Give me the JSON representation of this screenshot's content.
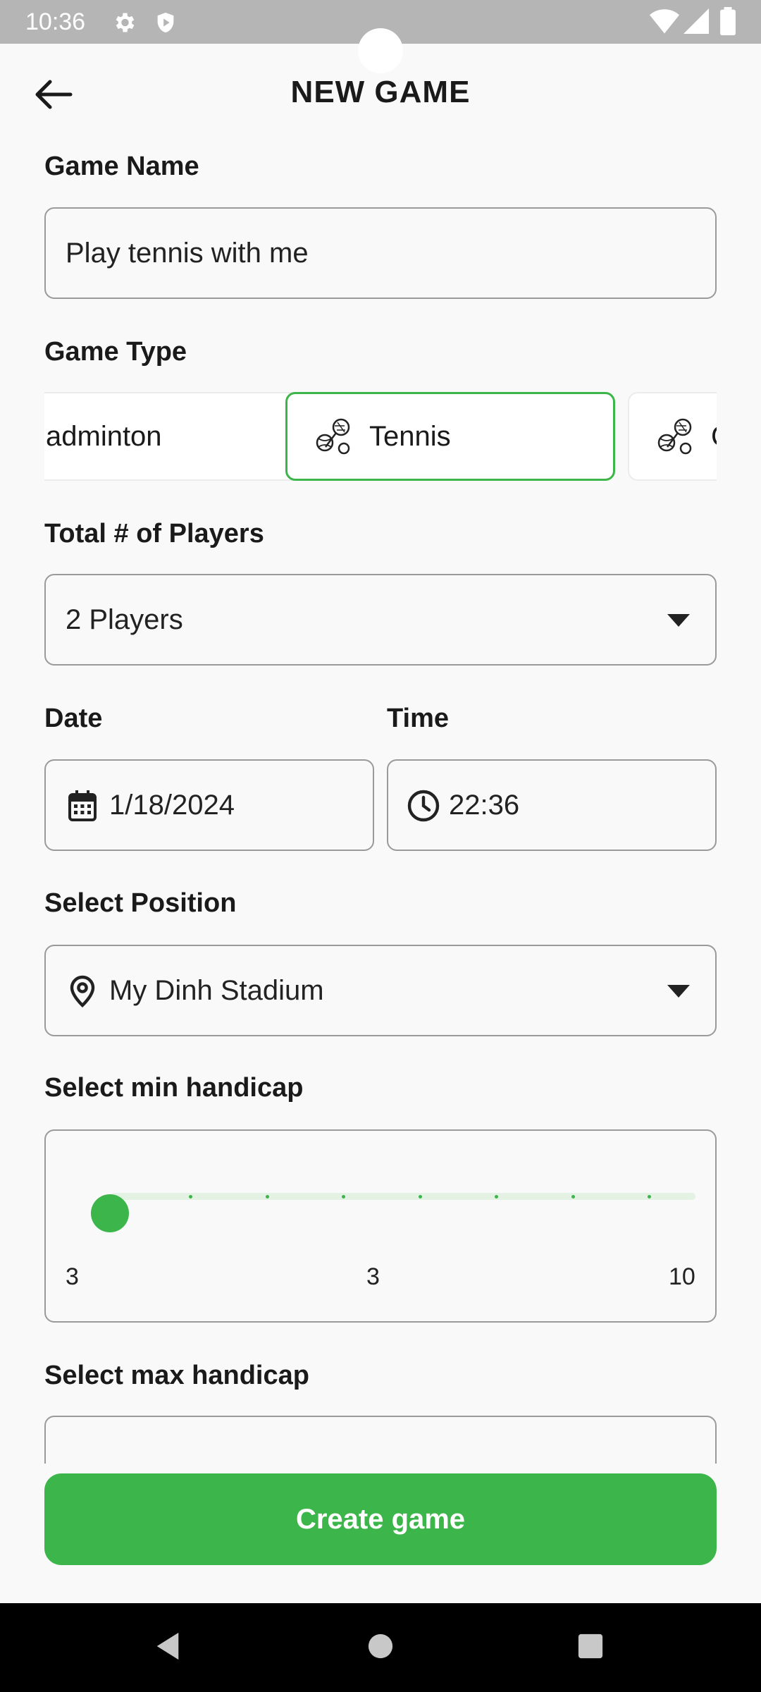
{
  "status_bar": {
    "time": "10:36",
    "icons": [
      "gear-icon",
      "shield-icon",
      "wifi-icon",
      "cell-signal-icon",
      "battery-icon"
    ]
  },
  "app_bar": {
    "title": "NEW GAME",
    "back_icon": "arrow-left-icon"
  },
  "game_name": {
    "label": "Game Name",
    "value": "Play tennis with me"
  },
  "game_type": {
    "label": "Game Type",
    "options": [
      {
        "label": "adminton",
        "selected": false
      },
      {
        "label": "Tennis",
        "selected": true
      },
      {
        "label": "C",
        "selected": false
      }
    ]
  },
  "players": {
    "label": "Total # of Players",
    "value": "2 Players"
  },
  "date": {
    "label": "Date",
    "value": "1/18/2024"
  },
  "time": {
    "label": "Time",
    "value": "22:36"
  },
  "position": {
    "label": "Select Position",
    "value": "My Dinh Stadium"
  },
  "min_handicap": {
    "label": "Select min handicap",
    "min_label": "3",
    "current_label": "3",
    "max_label": "10",
    "value": 3,
    "min": 3,
    "max": 10
  },
  "max_handicap": {
    "label": "Select max handicap"
  },
  "create_button": {
    "label": "Create game"
  },
  "colors": {
    "accent": "#3cb54a",
    "status_bar": "#b5b5b5",
    "background": "#f9f9f9"
  }
}
